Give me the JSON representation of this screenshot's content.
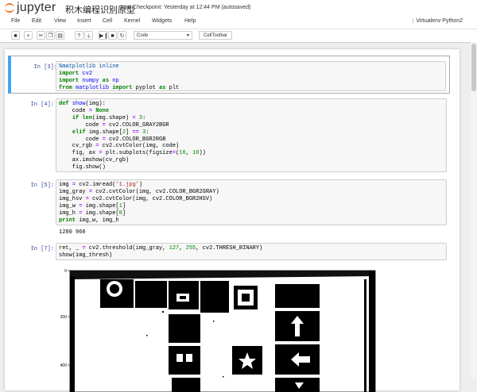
{
  "header": {
    "logo_text": "jupyter",
    "notebook_name": "积木编程识别原型",
    "checkpoint": "Last Checkpoint: Yesterday at 12:44 PM (autosaved)"
  },
  "menu": {
    "items": [
      "File",
      "Edit",
      "View",
      "Insert",
      "Cell",
      "Kernel",
      "Widgets",
      "Help"
    ],
    "kernel": "Virtualenv Python2"
  },
  "toolbar": {
    "icons": [
      "save-icon",
      "plus-icon",
      "cut-icon",
      "copy-icon",
      "paste-icon",
      "arrow-up-icon",
      "arrow-down-icon",
      "run-icon",
      "stop-icon",
      "restart-icon"
    ],
    "cell_type": "Code",
    "celltoolbar_label": "CellToolbar"
  },
  "cells": [
    {
      "prompt": "In [3]:",
      "output": ""
    },
    {
      "prompt": "In [4]:",
      "output": ""
    },
    {
      "prompt": "In [5]:",
      "output": "1280 960"
    },
    {
      "prompt": "In [7]:",
      "output": ""
    }
  ],
  "plot": {
    "y_ticks": [
      "0",
      "200",
      "400"
    ]
  }
}
